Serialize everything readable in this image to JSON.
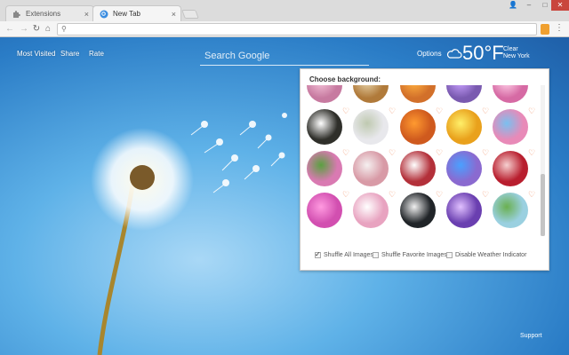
{
  "browser": {
    "tabs": [
      {
        "label": "Extensions",
        "active": false
      },
      {
        "label": "New Tab",
        "active": true
      }
    ],
    "close_glyph": "×",
    "window_controls": {
      "user": "👤",
      "minimize": "–",
      "maximize": "□",
      "close": "✕"
    },
    "toolbar": {
      "back": "←",
      "forward": "→",
      "reload": "↻",
      "home": "⌂",
      "omnibox_value": "",
      "search_glyph": "⚲",
      "menu": "⋮"
    }
  },
  "newtab": {
    "nav_links": [
      "Most Visited",
      "Share",
      "Rate"
    ],
    "search_placeholder": "Search Google",
    "options_label": "Options",
    "weather": {
      "temp": "50°F",
      "condition": "Clear",
      "city": "New York"
    },
    "support_label": "Support"
  },
  "background_panel": {
    "title": "Choose background:",
    "heart_glyph": "♡",
    "rows": [
      [
        "Pink flower",
        "Pink flower",
        "Orange flowers",
        "Purple flowers",
        "Pink flowers"
      ],
      [
        "White orchid on stones",
        "White flowers",
        "Orange marigolds",
        "Yellow gerbera",
        "Pink field"
      ],
      [
        "Pink cherry blossom tree",
        "Pink blossoms",
        "Red and white flowers",
        "Purple blossoms",
        "Red roses"
      ],
      [
        "Pink flowers",
        "Pink peonies",
        "Dark flowers",
        "Purple crocus",
        "Flower tunnel"
      ]
    ],
    "options": [
      {
        "label": "Shuffle All Images",
        "checked": true
      },
      {
        "label": "Shuffle Favorite Images",
        "checked": false
      },
      {
        "label": "Disable Weather Indicator",
        "checked": false
      }
    ]
  },
  "colors": {
    "sky": "#2a7cc6",
    "heart": "#f08a5a",
    "close_button": "#c9463d"
  }
}
